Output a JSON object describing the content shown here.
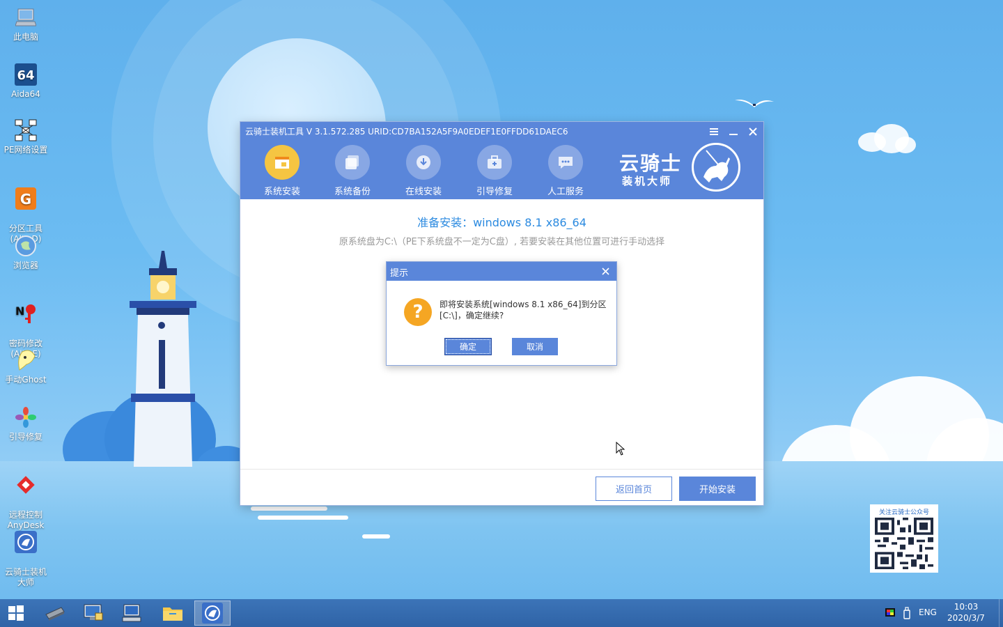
{
  "desktop_icons": [
    {
      "label": "此电脑",
      "icon": "computer-icon"
    },
    {
      "label": "Aida64",
      "icon": "aida64-icon"
    },
    {
      "label": "PE网络设置",
      "icon": "network-icon"
    },
    {
      "label": "分区工具\n(Alt+D)",
      "icon": "diskgenius-icon"
    },
    {
      "label": "浏览器",
      "icon": "browser-icon"
    },
    {
      "label": "密码修改\n(Alt+E)",
      "icon": "password-icon"
    },
    {
      "label": "手动Ghost",
      "icon": "ghost-icon"
    },
    {
      "label": "引导修复",
      "icon": "boot-repair-icon"
    },
    {
      "label": "远程控制\nAnyDesk",
      "icon": "anydesk-icon"
    },
    {
      "label": "云骑士装机\n大师",
      "icon": "yunqishi-icon"
    }
  ],
  "window": {
    "title": "云骑士装机工具 V 3.1.572.285 URID:CD7BA152A5F9A0EDEF1E0FFDD61DAEC6",
    "nav": [
      {
        "label": "系统安装",
        "active": true
      },
      {
        "label": "系统备份",
        "active": false
      },
      {
        "label": "在线安装",
        "active": false
      },
      {
        "label": "引导修复",
        "active": false
      },
      {
        "label": "人工服务",
        "active": false
      }
    ],
    "brand_main": "云骑士",
    "brand_sub": "装机大师",
    "heading": "准备安装：windows 8.1 x86_64",
    "subtext": "原系统盘为C:\\（PE下系统盘不一定为C盘）, 若要安装在其他位置可进行手动选择",
    "back_button": "返回首页",
    "start_button": "开始安装"
  },
  "dialog": {
    "title": "提示",
    "message": "即将安装系统[windows 8.1 x86_64]到分区[C:\\]，确定继续?",
    "ok": "确定",
    "cancel": "取消"
  },
  "qr": {
    "title": "关注云骑士公众号"
  },
  "taskbar": {
    "language": "ENG",
    "time": "10:03",
    "date": "2020/3/7"
  },
  "colors": {
    "accent": "#5a86da",
    "heading": "#2b8ae0",
    "active_nav": "#f5c542",
    "question": "#f5a623"
  }
}
